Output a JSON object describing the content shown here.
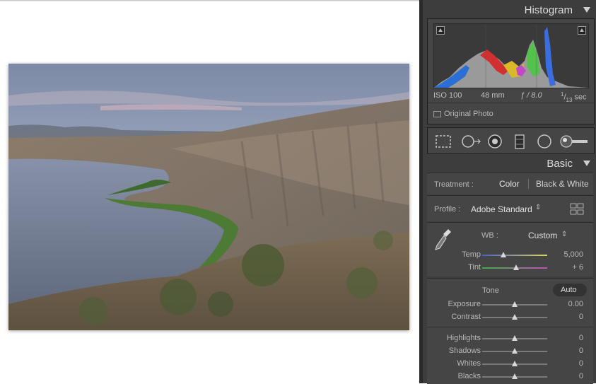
{
  "histogram": {
    "title": "Histogram",
    "iso": "ISO 100",
    "focal": "48 mm",
    "aperture": "ƒ / 8.0",
    "shutter_num": "1",
    "shutter_den": "13",
    "shutter_unit": "sec",
    "original_photo": "Original Photo"
  },
  "basic": {
    "title": "Basic",
    "treatment_label": "Treatment :",
    "treatment_color": "Color",
    "treatment_bw": "Black & White",
    "profile_label": "Profile :",
    "profile_value": "Adobe Standard",
    "wb_label": "WB :",
    "wb_value": "Custom",
    "tone_label": "Tone",
    "auto_label": "Auto",
    "sliders": [
      {
        "label": "Temp",
        "value": "5,000",
        "level": 0.33
      },
      {
        "label": "Tint",
        "value": "+ 6",
        "level": 0.52
      },
      {
        "label": "Exposure",
        "value": "0.00",
        "level": 0.5
      },
      {
        "label": "Contrast",
        "value": "0",
        "level": 0.5
      },
      {
        "label": "Highlights",
        "value": "0",
        "level": 0.5
      },
      {
        "label": "Shadows",
        "value": "0",
        "level": 0.5
      },
      {
        "label": "Whites",
        "value": "0",
        "level": 0.5
      },
      {
        "label": "Blacks",
        "value": "0",
        "level": 0.5
      }
    ]
  },
  "colors": {
    "panel_bg": "#3d3d3d",
    "section_bg": "#454545",
    "temp_gradient": [
      "#4f5fd0",
      "#d8d85a"
    ],
    "tint_gradient": [
      "#3fb03f",
      "#c24fc2"
    ]
  }
}
